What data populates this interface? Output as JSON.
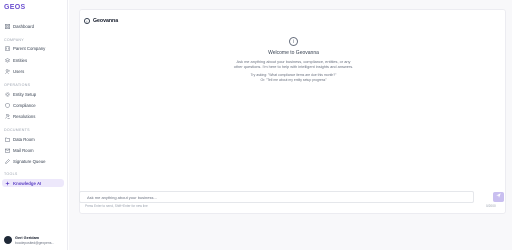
{
  "brand": "GEOS",
  "sidebar": {
    "items": [
      {
        "label": "Dashboard",
        "icon": "grid-icon"
      },
      {
        "label": "Parent Company",
        "icon": "building-icon"
      },
      {
        "label": "Entities",
        "icon": "layers-icon"
      },
      {
        "label": "Users",
        "icon": "users-icon"
      },
      {
        "label": "Entity Setup",
        "icon": "gear-icon"
      },
      {
        "label": "Compliance",
        "icon": "shield-icon"
      },
      {
        "label": "Resolutions",
        "icon": "gavel-icon"
      },
      {
        "label": "Data Room",
        "icon": "folder-icon"
      },
      {
        "label": "Mail Room",
        "icon": "mail-icon"
      },
      {
        "label": "Signature Queue",
        "icon": "pen-icon"
      },
      {
        "label": "Knowledge AI",
        "icon": "sparkle-icon",
        "active": true
      }
    ],
    "sections": {
      "company": "COMPANY",
      "operations": "OPERATIONS",
      "documents": "DOCUMENTS",
      "tools": "TOOLS"
    }
  },
  "user": {
    "name": "Geri Geridam",
    "email": "bocdeposited@gexpens..."
  },
  "panel": {
    "title": "Geovanna",
    "welcome_title": "Welcome to Geovanna",
    "welcome_desc": "Ask me anything about your business, compliance, entities, or any other questions. I'm here to help with intelligent insights and answers.",
    "example_1": "Try asking: \"What compliance items are due this month?\"",
    "example_2": "Or: \"Tell me about my entity setup progress\""
  },
  "chat": {
    "placeholder": "Ask me anything about your business...",
    "hint": "Press Enter to send, Shift+Enter for new line",
    "counter": "0/2000"
  },
  "colors": {
    "accent": "#6b4fcf",
    "active_bg": "#ede8fb",
    "send_button": "#c9bff0"
  }
}
